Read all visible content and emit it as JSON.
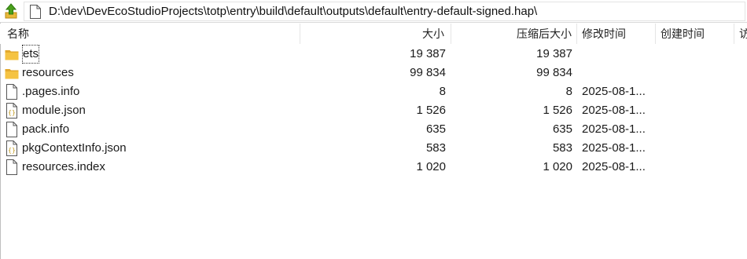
{
  "pathbar": {
    "path": "D:\\dev\\DevEcoStudioProjects\\totp\\entry\\build\\default\\outputs\\default\\entry-default-signed.hap\\"
  },
  "columns": {
    "name": "名称",
    "size": "大小",
    "packed": "压缩后大小",
    "modified": "修改时间",
    "created": "创建时间",
    "accessed": "访"
  },
  "files": [
    {
      "name": "ets",
      "icon": "folder-icon",
      "size": "19 387",
      "packed": "19 387",
      "modified": ""
    },
    {
      "name": "resources",
      "icon": "folder-icon",
      "size": "99 834",
      "packed": "99 834",
      "modified": ""
    },
    {
      "name": ".pages.info",
      "icon": "file-icon",
      "size": "8",
      "packed": "8",
      "modified": "2025-08-1..."
    },
    {
      "name": "module.json",
      "icon": "json-file-icon",
      "size": "1 526",
      "packed": "1 526",
      "modified": "2025-08-1..."
    },
    {
      "name": "pack.info",
      "icon": "file-icon",
      "size": "635",
      "packed": "635",
      "modified": "2025-08-1..."
    },
    {
      "name": "pkgContextInfo.json",
      "icon": "json-file-icon",
      "size": "583",
      "packed": "583",
      "modified": "2025-08-1..."
    },
    {
      "name": "resources.index",
      "icon": "file-icon",
      "size": "1 020",
      "packed": "1 020",
      "modified": "2025-08-1..."
    }
  ],
  "colors": {
    "folder": "#f5c342",
    "folder_dark": "#e3a92c",
    "up_arrow": "#4aa01c",
    "json_brace": "#c29a1c"
  }
}
